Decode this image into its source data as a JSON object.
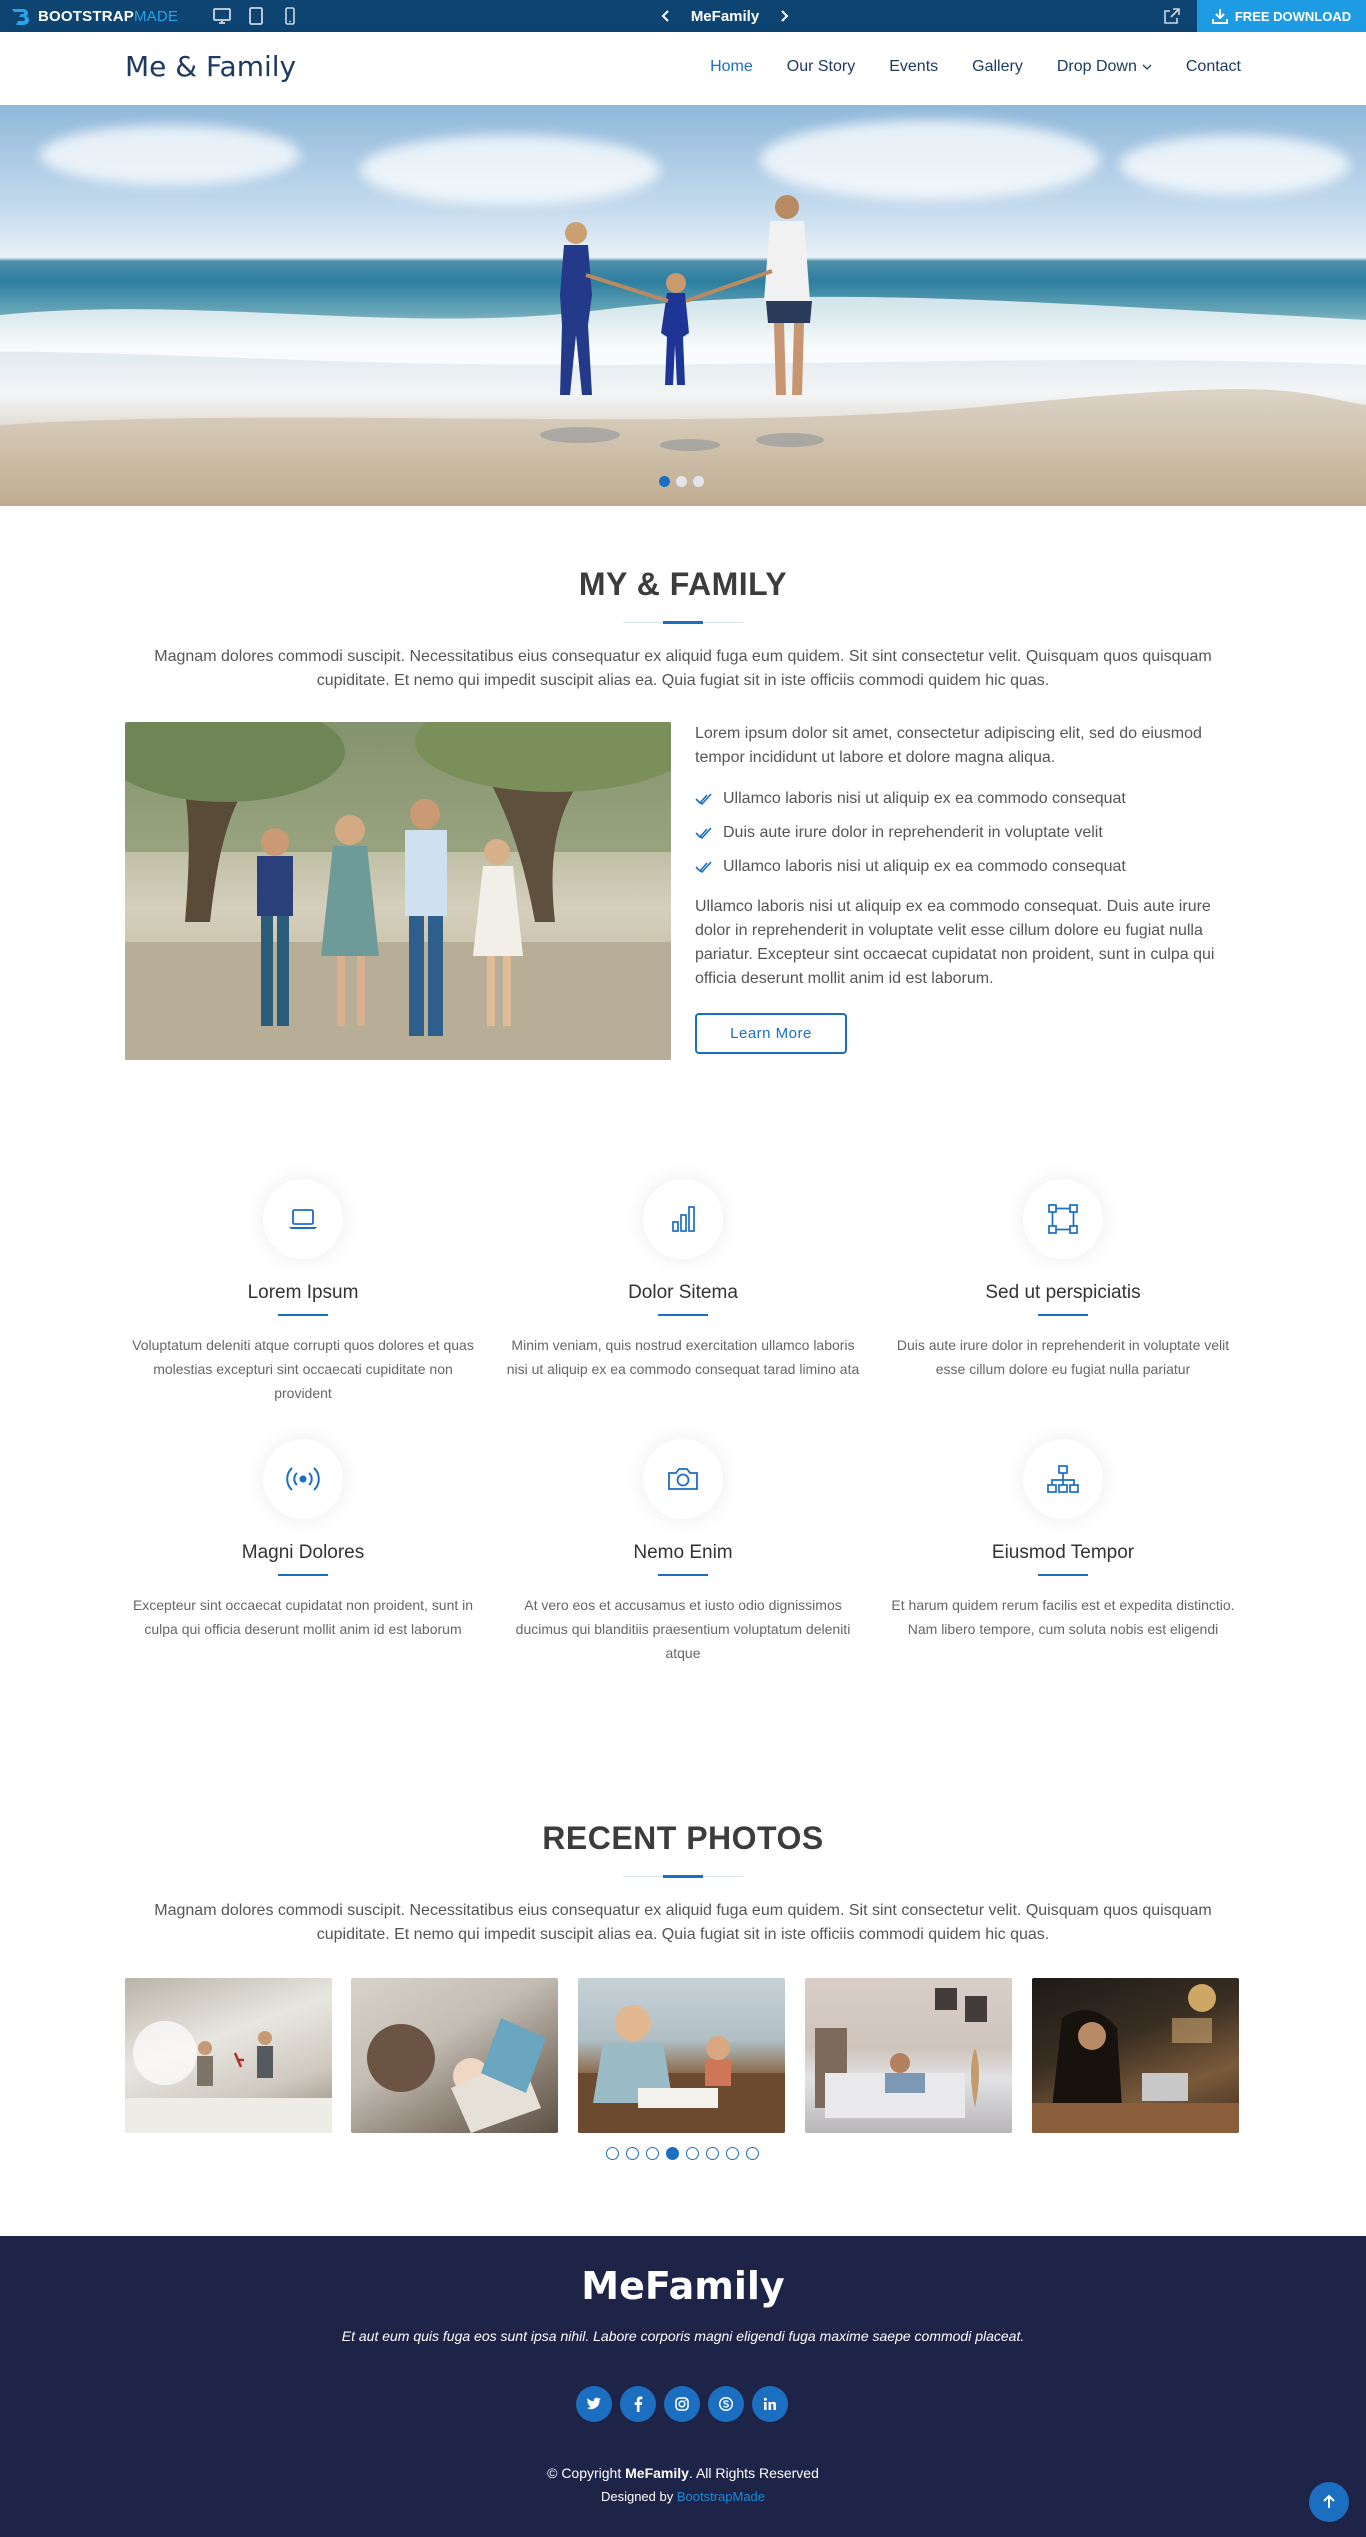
{
  "preview_bar": {
    "logo_main": "BOOTSTRAP",
    "logo_accent": "MADE",
    "devices": [
      "desktop-icon",
      "tablet-icon",
      "mobile-icon"
    ],
    "template_name": "MeFamily",
    "download_label": "FREE DOWNLOAD"
  },
  "header": {
    "brand": "Me & Family",
    "nav": [
      "Home",
      "Our Story",
      "Events",
      "Gallery",
      "Drop Down",
      "Contact"
    ],
    "active": "Home"
  },
  "hero": {
    "slides": 3,
    "active_slide": 1
  },
  "about": {
    "title": "MY & FAMILY",
    "intro": "Magnam dolores commodi suscipit. Necessitatibus eius consequatur ex aliquid fuga eum quidem. Sit sint consectetur velit. Quisquam quos quisquam cupiditate. Et nemo qui impedit suscipit alias ea. Quia fugiat sit in iste officiis commodi quidem hic quas.",
    "lead": "Lorem ipsum dolor sit amet, consectetur adipiscing elit, sed do eiusmod tempor incididunt ut labore et dolore magna aliqua.",
    "checks": [
      "Ullamco laboris nisi ut aliquip ex ea commodo consequat",
      "Duis aute irure dolor in reprehenderit in voluptate velit",
      "Ullamco laboris nisi ut aliquip ex ea commodo consequat"
    ],
    "body": "Ullamco laboris nisi ut aliquip ex ea commodo consequat. Duis aute irure dolor in reprehenderit in voluptate velit esse cillum dolore eu fugiat nulla pariatur. Excepteur sint occaecat cupidatat non proident, sunt in culpa qui officia deserunt mollit anim id est laborum.",
    "button": "Learn More"
  },
  "services": [
    {
      "icon": "laptop-icon",
      "title": "Lorem Ipsum",
      "text": "Voluptatum deleniti atque corrupti quos dolores et quas molestias excepturi sint occaecati cupiditate non provident"
    },
    {
      "icon": "bar-chart-icon",
      "title": "Dolor Sitema",
      "text": "Minim veniam, quis nostrud exercitation ullamco laboris nisi ut aliquip ex ea commodo consequat tarad limino ata"
    },
    {
      "icon": "bounding-box-icon",
      "title": "Sed ut perspiciatis",
      "text": "Duis aute irure dolor in reprehenderit in voluptate velit esse cillum dolore eu fugiat nulla pariatur"
    },
    {
      "icon": "broadcast-icon",
      "title": "Magni Dolores",
      "text": "Excepteur sint occaecat cupidatat non proident, sunt in culpa qui officia deserunt mollit anim id est laborum"
    },
    {
      "icon": "camera-icon",
      "title": "Nemo Enim",
      "text": "At vero eos et accusamus et iusto odio dignissimos ducimus qui blanditiis praesentium voluptatum deleniti atque"
    },
    {
      "icon": "diagram-icon",
      "title": "Eiusmod Tempor",
      "text": "Et harum quidem rerum facilis est et expedita distinctio. Nam libero tempore, cum soluta nobis est eligendi"
    }
  ],
  "photos": {
    "title": "RECENT PHOTOS",
    "intro": "Magnam dolores commodi suscipit. Necessitatibus eius consequatur ex aliquid fuga eum quidem. Sit sint consectetur velit. Quisquam quos quisquam cupiditate. Et nemo qui impedit suscipit alias ea. Quia fugiat sit in iste officiis commodi quidem hic quas.",
    "pages": 8,
    "active_page": 4
  },
  "footer": {
    "brand": "MeFamily",
    "tagline": "Et aut eum quis fuga eos sunt ipsa nihil. Labore corporis magni eligendi fuga maxime saepe commodi placeat.",
    "socials": [
      "twitter-icon",
      "facebook-icon",
      "instagram-icon",
      "skype-icon",
      "linkedin-icon"
    ],
    "copy_prefix": "© Copyright ",
    "copy_brand": "MeFamily",
    "copy_suffix": ". All Rights Reserved",
    "designed_by": "Designed by ",
    "designer": "BootstrapMade"
  },
  "colors": {
    "accent": "#1c6ec1",
    "preview_bar": "#0e4472",
    "download": "#1d9ce4",
    "footer_bg": "#1e2448",
    "heading": "#1e3a63"
  }
}
